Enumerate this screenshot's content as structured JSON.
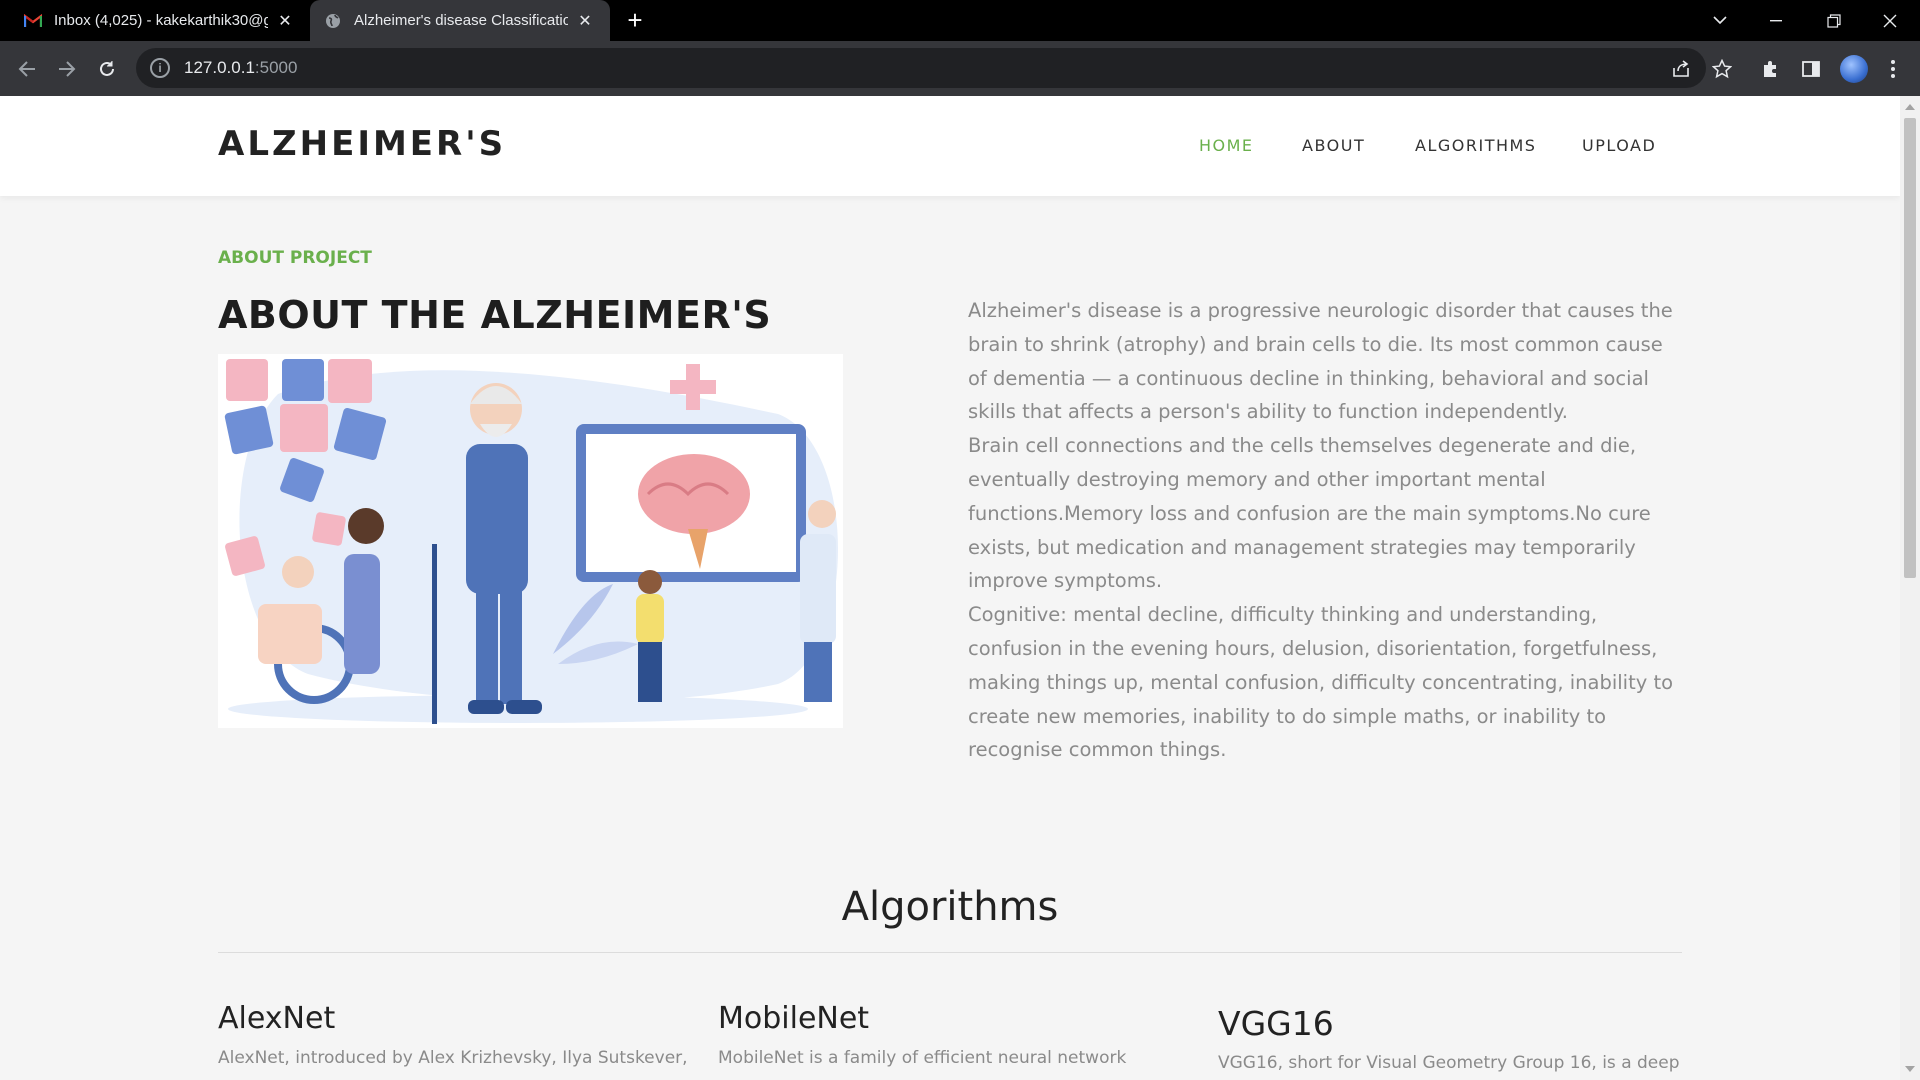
{
  "browser": {
    "tabs": [
      {
        "title": "Inbox (4,025) - kakekarthik30@g",
        "icon": "gmail-icon",
        "active": false
      },
      {
        "title": "Alzheimer's disease Classificatio",
        "icon": "globe-icon",
        "active": true
      }
    ],
    "url_host": "127.0.0.1",
    "url_port": ":5000",
    "accent": "#35363a"
  },
  "site": {
    "brand": "ALZHEIMER'S",
    "nav": [
      "HOME",
      "ABOUT",
      "ALGORITHMS",
      "UPLOAD"
    ],
    "accent_color": "#6ab04c"
  },
  "about": {
    "eyebrow": "ABOUT PROJECT",
    "title": "ABOUT THE ALZHEIMER'S",
    "paragraphs": [
      "Alzheimer's disease is a progressive neurologic disorder that causes the brain to shrink (atrophy) and brain cells to die. Its most common cause of dementia — a continuous decline in thinking, behavioral and social skills that affects a person's ability to function independently.",
      "Brain cell connections and the cells themselves degenerate and die, eventually destroying memory and other important mental functions.Memory loss and confusion are the main symptoms.No cure exists, but medication and management strategies may temporarily improve symptoms.",
      "Cognitive: mental decline, difficulty thinking and understanding, confusion in the evening hours, delusion, disorientation, forgetfulness, making things up, mental confusion, difficulty concentrating, inability to create new memories, inability to do simple maths, or inability to recognise common things."
    ]
  },
  "algorithms": {
    "heading": "Algorithms",
    "items": [
      {
        "name": "AlexNet",
        "desc": "AlexNet, introduced by Alex Krizhevsky, Ilya Sutskever,"
      },
      {
        "name": "MobileNet",
        "desc": "MobileNet is a family of efficient neural network"
      },
      {
        "name": "VGG16",
        "desc": "VGG16, short for Visual Geometry Group 16, is a deep"
      }
    ]
  }
}
